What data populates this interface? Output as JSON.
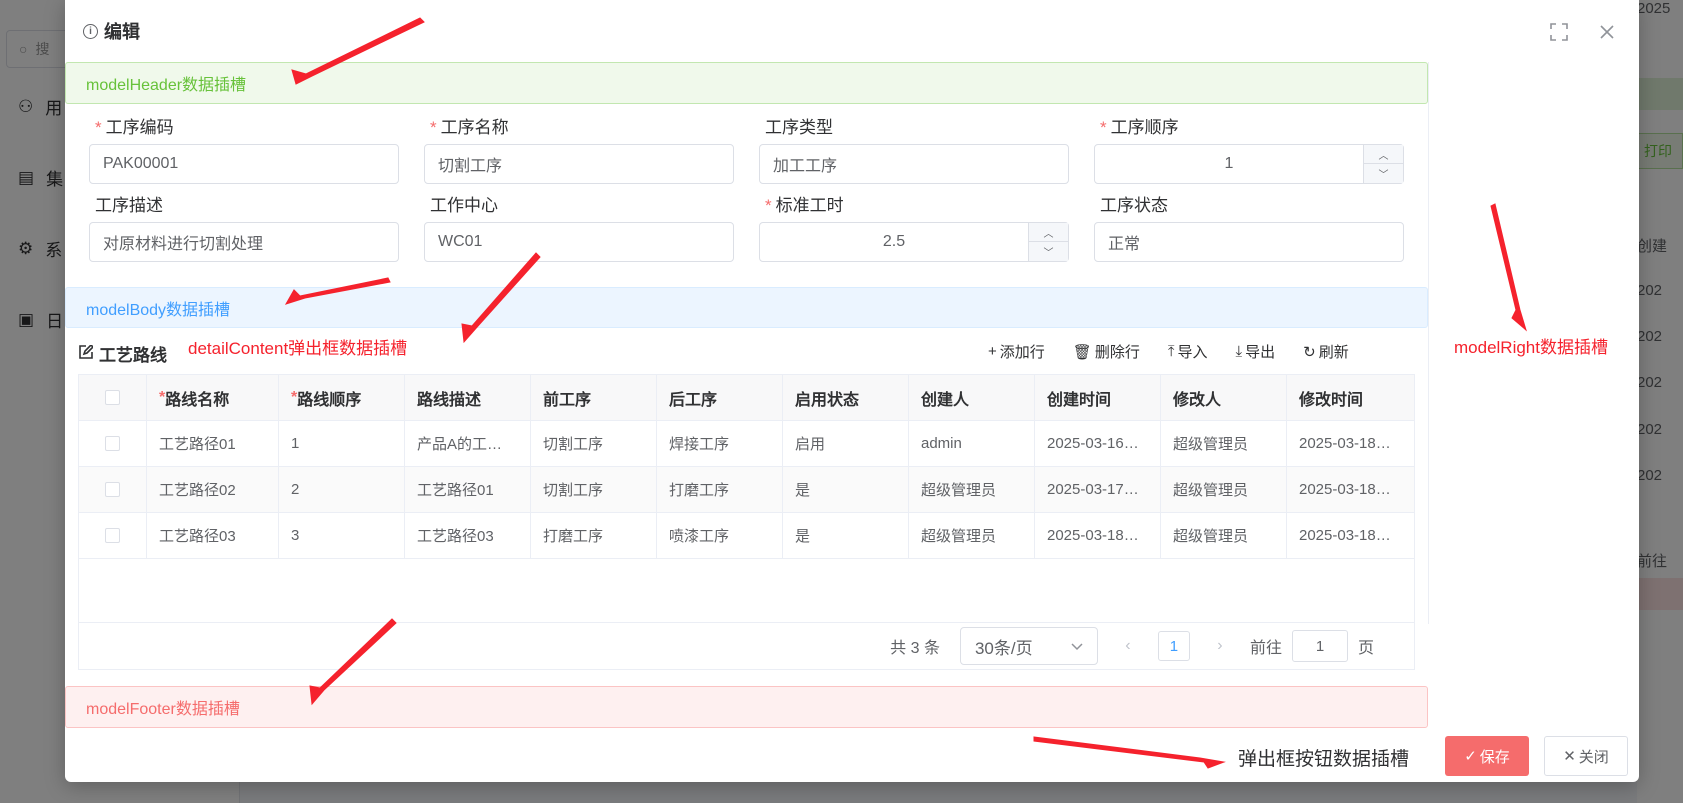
{
  "background": {
    "search_placeholder": "搜",
    "menu_items": [
      "用",
      "集",
      "系",
      "日"
    ],
    "right_items": [
      "2025",
      "打印",
      "创建",
      "202",
      "202",
      "202",
      "202",
      "202",
      "前往"
    ]
  },
  "dialog": {
    "title": "编辑",
    "slots": {
      "header": "modelHeader数据插槽",
      "body": "modelBody数据插槽",
      "footer": "modelFooter数据插槽",
      "right": "modelRight数据插槽",
      "detail": "detailContent弹出框数据插槽",
      "buttons": "弹出框按钮数据插槽"
    },
    "form": {
      "code": {
        "label": "工序编码",
        "required": true,
        "value": "PAK00001"
      },
      "name": {
        "label": "工序名称",
        "required": true,
        "value": "切割工序"
      },
      "type": {
        "label": "工序类型",
        "required": false,
        "value": "加工工序"
      },
      "order": {
        "label": "工序顺序",
        "required": true,
        "value": "1"
      },
      "desc": {
        "label": "工序描述",
        "required": false,
        "value": "对原材料进行切割处理"
      },
      "center": {
        "label": "工作中心",
        "required": false,
        "value": "WC01"
      },
      "std_time": {
        "label": "标准工时",
        "required": true,
        "value": "2.5"
      },
      "status": {
        "label": "工序状态",
        "required": false,
        "value": "正常"
      }
    },
    "detail": {
      "title": "工艺路线",
      "toolbar": {
        "add": "添加行",
        "delete": "删除行",
        "import": "导入",
        "export": "导出",
        "refresh": "刷新"
      },
      "columns": [
        "路线名称",
        "路线顺序",
        "路线描述",
        "前工序",
        "后工序",
        "启用状态",
        "创建人",
        "创建时间",
        "修改人",
        "修改时间"
      ],
      "required_columns": [
        0,
        1
      ],
      "rows": [
        [
          "工艺路径01",
          "1",
          "产品A的工…",
          "切割工序",
          "焊接工序",
          "启用",
          "admin",
          "2025-03-16…",
          "超级管理员",
          "2025-03-18…"
        ],
        [
          "工艺路径02",
          "2",
          "工艺路径01",
          "切割工序",
          "打磨工序",
          "是",
          "超级管理员",
          "2025-03-17…",
          "超级管理员",
          "2025-03-18…"
        ],
        [
          "工艺路径03",
          "3",
          "工艺路径03",
          "打磨工序",
          "喷漆工序",
          "是",
          "超级管理员",
          "2025-03-18…",
          "超级管理员",
          "2025-03-18…"
        ]
      ],
      "pager": {
        "total": "共 3 条",
        "page_size": "30条/页",
        "current": "1",
        "goto_label": "前往",
        "goto_value": "1",
        "page_unit": "页"
      }
    },
    "buttons": {
      "save": "保存",
      "close": "关闭"
    }
  },
  "colors": {
    "danger": "#f56c6c",
    "primary": "#409eff",
    "success": "#67c23a",
    "annotation": "#f5222d"
  }
}
